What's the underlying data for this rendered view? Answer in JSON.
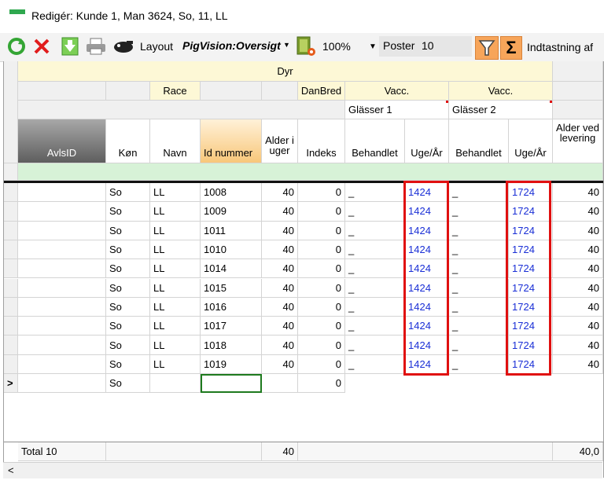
{
  "window": {
    "title": "Redigér: Kunde 1, Man 3624, So, 11, LL",
    "accent": "#2fa84f"
  },
  "toolbar": {
    "layout_label": "Layout",
    "layout_name": "PigVision:Oversigt",
    "zoom": "100%",
    "poster_label": "Poster",
    "poster_value": "10",
    "sum_symbol": "Σ",
    "indtastning_label": "Indtastning af",
    "filter_color": "#f7a55a"
  },
  "grid": {
    "band": {
      "dyr": "Dyr",
      "race": "Race",
      "danbred": "DanBred",
      "vacc1": "Vacc.",
      "vacc2": "Vacc.",
      "glasser1": "Glässer 1",
      "glasser2": "Glässer 2"
    },
    "columns": {
      "avlsid": "AvlsID",
      "kon": "Køn",
      "navn": "Navn",
      "id_nummer": "Id nummer",
      "alder_uger": "Alder i uger",
      "indeks": "Indeks",
      "behandlet1": "Behandlet",
      "uge_aar1": "Uge/År",
      "behandlet2": "Behandlet",
      "uge_aar2": "Uge/År",
      "alder_levering": "Alder ved levering"
    },
    "rows": [
      {
        "kon": "So",
        "navn": "LL",
        "id": "1008",
        "alder": "40",
        "indeks": "0",
        "beh1": "_",
        "uge1": "1424",
        "beh2": "_",
        "uge2": "1724",
        "alder_lev": "40"
      },
      {
        "kon": "So",
        "navn": "LL",
        "id": "1009",
        "alder": "40",
        "indeks": "0",
        "beh1": "_",
        "uge1": "1424",
        "beh2": "_",
        "uge2": "1724",
        "alder_lev": "40"
      },
      {
        "kon": "So",
        "navn": "LL",
        "id": "1011",
        "alder": "40",
        "indeks": "0",
        "beh1": "_",
        "uge1": "1424",
        "beh2": "_",
        "uge2": "1724",
        "alder_lev": "40"
      },
      {
        "kon": "So",
        "navn": "LL",
        "id": "1010",
        "alder": "40",
        "indeks": "0",
        "beh1": "_",
        "uge1": "1424",
        "beh2": "_",
        "uge2": "1724",
        "alder_lev": "40"
      },
      {
        "kon": "So",
        "navn": "LL",
        "id": "1014",
        "alder": "40",
        "indeks": "0",
        "beh1": "_",
        "uge1": "1424",
        "beh2": "_",
        "uge2": "1724",
        "alder_lev": "40"
      },
      {
        "kon": "So",
        "navn": "LL",
        "id": "1015",
        "alder": "40",
        "indeks": "0",
        "beh1": "_",
        "uge1": "1424",
        "beh2": "_",
        "uge2": "1724",
        "alder_lev": "40"
      },
      {
        "kon": "So",
        "navn": "LL",
        "id": "1016",
        "alder": "40",
        "indeks": "0",
        "beh1": "_",
        "uge1": "1424",
        "beh2": "_",
        "uge2": "1724",
        "alder_lev": "40"
      },
      {
        "kon": "So",
        "navn": "LL",
        "id": "1017",
        "alder": "40",
        "indeks": "0",
        "beh1": "_",
        "uge1": "1424",
        "beh2": "_",
        "uge2": "1724",
        "alder_lev": "40"
      },
      {
        "kon": "So",
        "navn": "LL",
        "id": "1018",
        "alder": "40",
        "indeks": "0",
        "beh1": "_",
        "uge1": "1424",
        "beh2": "_",
        "uge2": "1724",
        "alder_lev": "40"
      },
      {
        "kon": "So",
        "navn": "LL",
        "id": "1019",
        "alder": "40",
        "indeks": "0",
        "beh1": "_",
        "uge1": "1424",
        "beh2": "_",
        "uge2": "1724",
        "alder_lev": "40"
      }
    ],
    "new_row": {
      "marker": ">",
      "kon": "So",
      "indeks": "0"
    },
    "total": {
      "label": "Total 10",
      "alder": "40",
      "alder_lev": "40,0"
    },
    "scroll_left": "<"
  }
}
